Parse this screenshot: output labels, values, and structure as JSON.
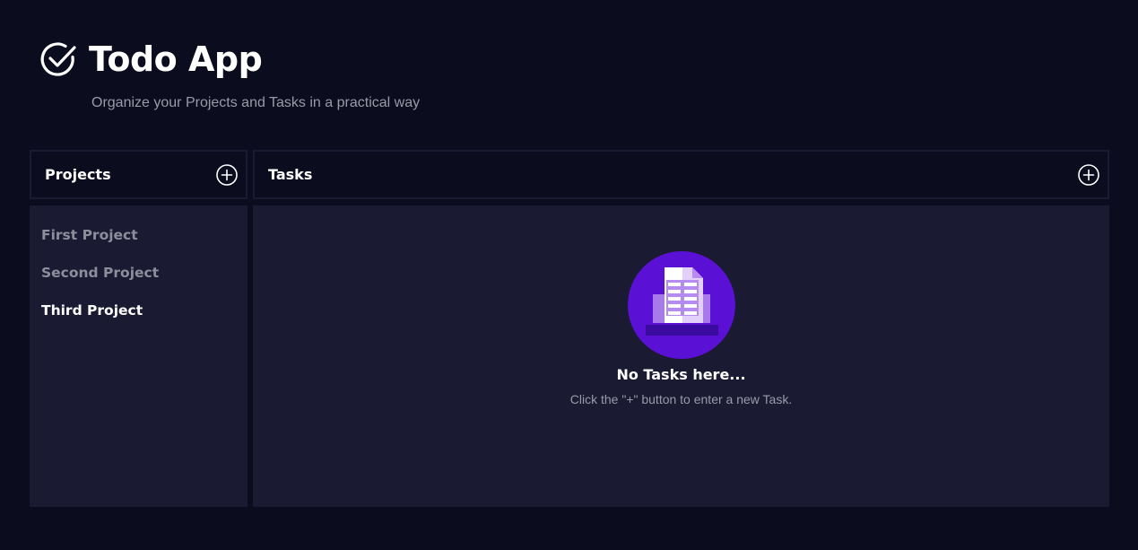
{
  "app": {
    "title": "Todo App",
    "subtitle": "Organize your Projects and Tasks in a practical way",
    "logo_icon": "check-circle-icon"
  },
  "projects": {
    "header": "Projects",
    "add_icon": "plus-circle-icon",
    "items": [
      {
        "label": "First Project",
        "active": false
      },
      {
        "label": "Second Project",
        "active": false
      },
      {
        "label": "Third Project",
        "active": true
      }
    ]
  },
  "tasks": {
    "header": "Tasks",
    "add_icon": "plus-circle-icon",
    "empty_state": {
      "icon": "document-illustration-icon",
      "title": "No Tasks here...",
      "hint": "Click the \"+\" button to enter a new Task."
    }
  },
  "colors": {
    "background": "#0b0c1d",
    "panel": "#1a1a33",
    "accent": "#5b10d6",
    "muted_text": "#9a9aa8"
  }
}
